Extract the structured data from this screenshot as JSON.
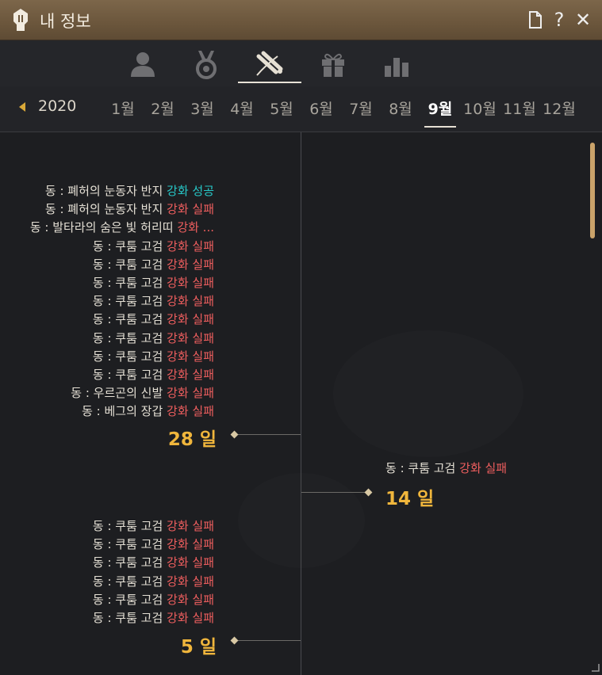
{
  "window": {
    "title": "내 정보"
  },
  "title_buttons": [
    {
      "name": "document-icon",
      "glyph": "▯"
    },
    {
      "name": "help-icon",
      "glyph": "?"
    },
    {
      "name": "close-icon",
      "glyph": "✕"
    }
  ],
  "tabs": [
    {
      "name": "tab-profile",
      "icon": "person-icon",
      "active": false
    },
    {
      "name": "tab-medal",
      "icon": "medal-icon",
      "active": false
    },
    {
      "name": "tab-history",
      "icon": "scroll-quill-icon",
      "active": true
    },
    {
      "name": "tab-gift",
      "icon": "gift-icon",
      "active": false
    },
    {
      "name": "tab-stats",
      "icon": "bar-chart-icon",
      "active": false
    }
  ],
  "calendar": {
    "year": "2020",
    "months": [
      "1월",
      "2월",
      "3월",
      "4월",
      "5월",
      "6월",
      "7월",
      "8월",
      "9월",
      "10월",
      "11월",
      "12월"
    ],
    "active_month": "9월"
  },
  "colors": {
    "success": "#27c8c8",
    "fail": "#ee5e5e",
    "day": "#f0b63c",
    "text": "#e4dfd4"
  },
  "timeline": [
    {
      "side": "left",
      "day": "28 일",
      "entries": [
        {
          "prefix": "동 : 폐허의 눈동자 반지 ",
          "result": "강화 성공",
          "status": "success"
        },
        {
          "prefix": "동 : 폐허의 눈동자 반지 ",
          "result": "강화 실패",
          "status": "fail"
        },
        {
          "prefix": "동 : 발타라의 숨은 빛 허리띠 ",
          "result": "강화 ...",
          "status": "fail"
        },
        {
          "prefix": "동 : 쿠툼 고검 ",
          "result": "강화 실패",
          "status": "fail"
        },
        {
          "prefix": "동 : 쿠툼 고검 ",
          "result": "강화 실패",
          "status": "fail"
        },
        {
          "prefix": "동 : 쿠툼 고검 ",
          "result": "강화 실패",
          "status": "fail"
        },
        {
          "prefix": "동 : 쿠툼 고검 ",
          "result": "강화 실패",
          "status": "fail"
        },
        {
          "prefix": "동 : 쿠툼 고검 ",
          "result": "강화 실패",
          "status": "fail"
        },
        {
          "prefix": "동 : 쿠툼 고검 ",
          "result": "강화 실패",
          "status": "fail"
        },
        {
          "prefix": "동 : 쿠툼 고검 ",
          "result": "강화 실패",
          "status": "fail"
        },
        {
          "prefix": "동 : 쿠툼 고검 ",
          "result": "강화 실패",
          "status": "fail"
        },
        {
          "prefix": "동 : 우르곤의 신발 ",
          "result": "강화 실패",
          "status": "fail"
        },
        {
          "prefix": "동 : 베그의 장갑 ",
          "result": "강화 실패",
          "status": "fail"
        }
      ]
    },
    {
      "side": "right",
      "day": "14 일",
      "entries": [
        {
          "prefix": "동 : 쿠툼 고검 ",
          "result": "강화 실패",
          "status": "fail"
        }
      ]
    },
    {
      "side": "left",
      "day": "5 일",
      "entries": [
        {
          "prefix": "동 : 쿠툼 고검 ",
          "result": "강화 실패",
          "status": "fail"
        },
        {
          "prefix": "동 : 쿠툼 고검 ",
          "result": "강화 실패",
          "status": "fail"
        },
        {
          "prefix": "동 : 쿠툼 고검 ",
          "result": "강화 실패",
          "status": "fail"
        },
        {
          "prefix": "동 : 쿠툼 고검 ",
          "result": "강화 실패",
          "status": "fail"
        },
        {
          "prefix": "동 : 쿠툼 고검 ",
          "result": "강화 실패",
          "status": "fail"
        },
        {
          "prefix": "동 : 쿠툼 고검 ",
          "result": "강화 실패",
          "status": "fail"
        }
      ]
    }
  ]
}
